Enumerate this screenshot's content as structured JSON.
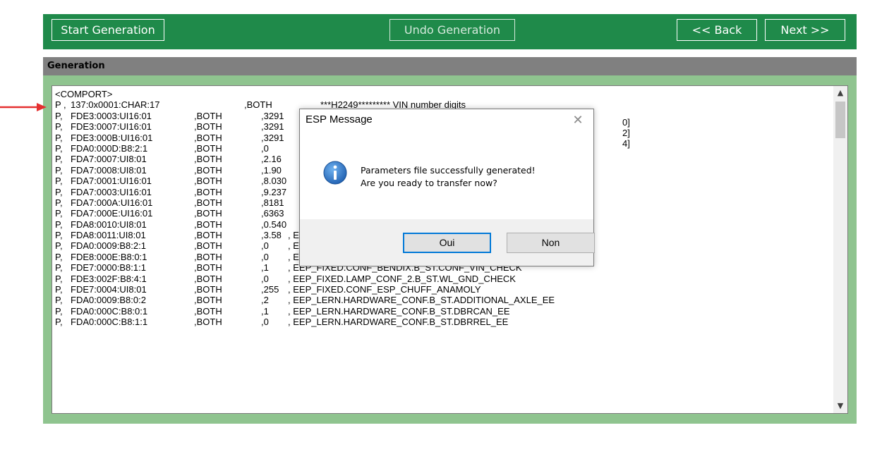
{
  "toolbar": {
    "start_label": "Start Generation",
    "undo_label": "Undo Generation",
    "back_label": "<< Back",
    "next_label": "Next >>"
  },
  "panel": {
    "title": "Generation"
  },
  "log": {
    "header": "<COMPORT>",
    "lines": [
      [
        "P ,",
        "137:0x0001:CHAR:17",
        ",BOTH",
        "",
        "***H2249********* VIN number digits"
      ],
      [
        "P,",
        "FDE3:0003:UI16:01",
        ",BOTH",
        ",3291",
        ""
      ],
      [
        "P,",
        "FDE3:0007:UI16:01",
        ",BOTH",
        ",3291",
        ""
      ],
      [
        "P,",
        "FDE3:000B:UI16:01",
        ",BOTH",
        ",3291",
        ""
      ],
      [
        "P,",
        "FDA0:000D:B8:2:1",
        ",BOTH",
        ",0",
        ""
      ],
      [
        "P,",
        "FDA7:0007:UI8:01",
        ",BOTH",
        ",2.16",
        ""
      ],
      [
        "P,",
        "FDA7:0008:UI8:01",
        ",BOTH",
        ",1.90",
        ""
      ],
      [
        "P,",
        "FDA7:0001:UI16:01",
        ",BOTH",
        ",8.030",
        ""
      ],
      [
        "P,",
        "FDA7:0003:UI16:01",
        ",BOTH",
        ",9.237",
        ""
      ],
      [
        "P,",
        "FDA7:000A:UI16:01",
        ",BOTH",
        ",8181",
        ""
      ],
      [
        "P,",
        "FDA7:000E:UI16:01",
        ",BOTH",
        ",6363",
        ""
      ],
      [
        "P,",
        "FDA8:0010:UI8:01",
        ",BOTH",
        ",0.540",
        ""
      ],
      [
        "P,",
        "FDA8:0011:UI8:01",
        ",BOTH",
        ",3.58",
        ", EEP_FIXED.I_RA"
      ],
      [
        "P,",
        "FDA0:0009:B8:2:1",
        ",BOTH",
        ",0",
        ", EEP_FIXED.WSP_CONF1.B_ST.AX_3_DRIVEN"
      ],
      [
        "P,",
        "FDE8:000E:B8:0:1",
        ",BOTH",
        ",0",
        ", EEP_FIXED.CONF_MISC.B_ST.CONF_BRAKE_LAMP_OUT"
      ],
      [
        "P,",
        "FDE7:0000:B8:1:1",
        ",BOTH",
        ",1",
        ", EEP_FIXED.CONF_BENDIX.B_ST.CONF_VIN_CHECK"
      ],
      [
        "P,",
        "FDE3:002F:B8:4:1",
        ",BOTH",
        ",0",
        ", EEP_FIXED.LAMP_CONF_2.B_ST.WL_GND_CHECK"
      ],
      [
        "P,",
        "FDE7:0004:UI8:01",
        ",BOTH",
        ",255",
        ", EEP_FIXED.CONF_ESP_CHUFF_ANAMOLY"
      ],
      [
        "P,",
        "FDA0:0009:B8:0:2",
        ",BOTH",
        ",2",
        ", EEP_LERN.HARDWARE_CONF.B_ST.ADDITIONAL_AXLE_EE"
      ],
      [
        "P,",
        "FDA0:000C:B8:0:1",
        ",BOTH",
        ",1",
        ", EEP_LERN.HARDWARE_CONF.B_ST.DBRCAN_EE"
      ],
      [
        "P,",
        "FDA0:000C:B8:1:1",
        ",BOTH",
        ",0",
        ", EEP_LERN.HARDWARE_CONF.B_ST.DBRREL_EE"
      ]
    ],
    "partial_right": [
      "0]",
      "2]",
      "4]"
    ]
  },
  "dialog": {
    "title": "ESP Message",
    "icon": "info-icon",
    "message_line1": "Parameters file successfully generated!",
    "message_line2": "Are you ready to transfer now?",
    "oui_label": "Oui",
    "non_label": "Non"
  },
  "colors": {
    "toolbar_bg": "#1f8a4a",
    "panel_bg": "#8fc48f",
    "header_bg": "#808080",
    "arrow": "#e53030",
    "info_icon": "#1f6fc2"
  }
}
